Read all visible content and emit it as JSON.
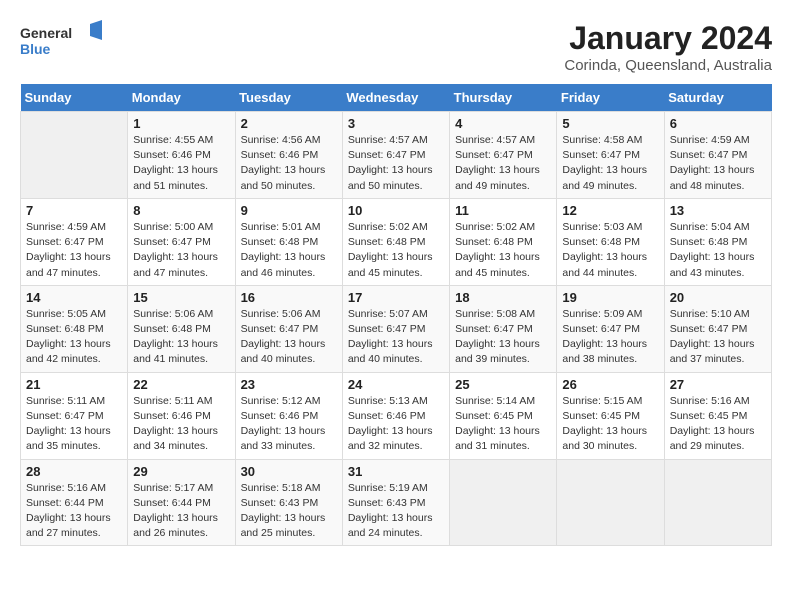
{
  "header": {
    "logo_general": "General",
    "logo_blue": "Blue",
    "month": "January 2024",
    "location": "Corinda, Queensland, Australia"
  },
  "weekdays": [
    "Sunday",
    "Monday",
    "Tuesday",
    "Wednesday",
    "Thursday",
    "Friday",
    "Saturday"
  ],
  "weeks": [
    [
      {
        "day": "",
        "info": ""
      },
      {
        "day": "1",
        "info": "Sunrise: 4:55 AM\nSunset: 6:46 PM\nDaylight: 13 hours\nand 51 minutes."
      },
      {
        "day": "2",
        "info": "Sunrise: 4:56 AM\nSunset: 6:46 PM\nDaylight: 13 hours\nand 50 minutes."
      },
      {
        "day": "3",
        "info": "Sunrise: 4:57 AM\nSunset: 6:47 PM\nDaylight: 13 hours\nand 50 minutes."
      },
      {
        "day": "4",
        "info": "Sunrise: 4:57 AM\nSunset: 6:47 PM\nDaylight: 13 hours\nand 49 minutes."
      },
      {
        "day": "5",
        "info": "Sunrise: 4:58 AM\nSunset: 6:47 PM\nDaylight: 13 hours\nand 49 minutes."
      },
      {
        "day": "6",
        "info": "Sunrise: 4:59 AM\nSunset: 6:47 PM\nDaylight: 13 hours\nand 48 minutes."
      }
    ],
    [
      {
        "day": "7",
        "info": "Sunrise: 4:59 AM\nSunset: 6:47 PM\nDaylight: 13 hours\nand 47 minutes."
      },
      {
        "day": "8",
        "info": "Sunrise: 5:00 AM\nSunset: 6:47 PM\nDaylight: 13 hours\nand 47 minutes."
      },
      {
        "day": "9",
        "info": "Sunrise: 5:01 AM\nSunset: 6:48 PM\nDaylight: 13 hours\nand 46 minutes."
      },
      {
        "day": "10",
        "info": "Sunrise: 5:02 AM\nSunset: 6:48 PM\nDaylight: 13 hours\nand 45 minutes."
      },
      {
        "day": "11",
        "info": "Sunrise: 5:02 AM\nSunset: 6:48 PM\nDaylight: 13 hours\nand 45 minutes."
      },
      {
        "day": "12",
        "info": "Sunrise: 5:03 AM\nSunset: 6:48 PM\nDaylight: 13 hours\nand 44 minutes."
      },
      {
        "day": "13",
        "info": "Sunrise: 5:04 AM\nSunset: 6:48 PM\nDaylight: 13 hours\nand 43 minutes."
      }
    ],
    [
      {
        "day": "14",
        "info": "Sunrise: 5:05 AM\nSunset: 6:48 PM\nDaylight: 13 hours\nand 42 minutes."
      },
      {
        "day": "15",
        "info": "Sunrise: 5:06 AM\nSunset: 6:48 PM\nDaylight: 13 hours\nand 41 minutes."
      },
      {
        "day": "16",
        "info": "Sunrise: 5:06 AM\nSunset: 6:47 PM\nDaylight: 13 hours\nand 40 minutes."
      },
      {
        "day": "17",
        "info": "Sunrise: 5:07 AM\nSunset: 6:47 PM\nDaylight: 13 hours\nand 40 minutes."
      },
      {
        "day": "18",
        "info": "Sunrise: 5:08 AM\nSunset: 6:47 PM\nDaylight: 13 hours\nand 39 minutes."
      },
      {
        "day": "19",
        "info": "Sunrise: 5:09 AM\nSunset: 6:47 PM\nDaylight: 13 hours\nand 38 minutes."
      },
      {
        "day": "20",
        "info": "Sunrise: 5:10 AM\nSunset: 6:47 PM\nDaylight: 13 hours\nand 37 minutes."
      }
    ],
    [
      {
        "day": "21",
        "info": "Sunrise: 5:11 AM\nSunset: 6:47 PM\nDaylight: 13 hours\nand 35 minutes."
      },
      {
        "day": "22",
        "info": "Sunrise: 5:11 AM\nSunset: 6:46 PM\nDaylight: 13 hours\nand 34 minutes."
      },
      {
        "day": "23",
        "info": "Sunrise: 5:12 AM\nSunset: 6:46 PM\nDaylight: 13 hours\nand 33 minutes."
      },
      {
        "day": "24",
        "info": "Sunrise: 5:13 AM\nSunset: 6:46 PM\nDaylight: 13 hours\nand 32 minutes."
      },
      {
        "day": "25",
        "info": "Sunrise: 5:14 AM\nSunset: 6:45 PM\nDaylight: 13 hours\nand 31 minutes."
      },
      {
        "day": "26",
        "info": "Sunrise: 5:15 AM\nSunset: 6:45 PM\nDaylight: 13 hours\nand 30 minutes."
      },
      {
        "day": "27",
        "info": "Sunrise: 5:16 AM\nSunset: 6:45 PM\nDaylight: 13 hours\nand 29 minutes."
      }
    ],
    [
      {
        "day": "28",
        "info": "Sunrise: 5:16 AM\nSunset: 6:44 PM\nDaylight: 13 hours\nand 27 minutes."
      },
      {
        "day": "29",
        "info": "Sunrise: 5:17 AM\nSunset: 6:44 PM\nDaylight: 13 hours\nand 26 minutes."
      },
      {
        "day": "30",
        "info": "Sunrise: 5:18 AM\nSunset: 6:43 PM\nDaylight: 13 hours\nand 25 minutes."
      },
      {
        "day": "31",
        "info": "Sunrise: 5:19 AM\nSunset: 6:43 PM\nDaylight: 13 hours\nand 24 minutes."
      },
      {
        "day": "",
        "info": ""
      },
      {
        "day": "",
        "info": ""
      },
      {
        "day": "",
        "info": ""
      }
    ]
  ]
}
